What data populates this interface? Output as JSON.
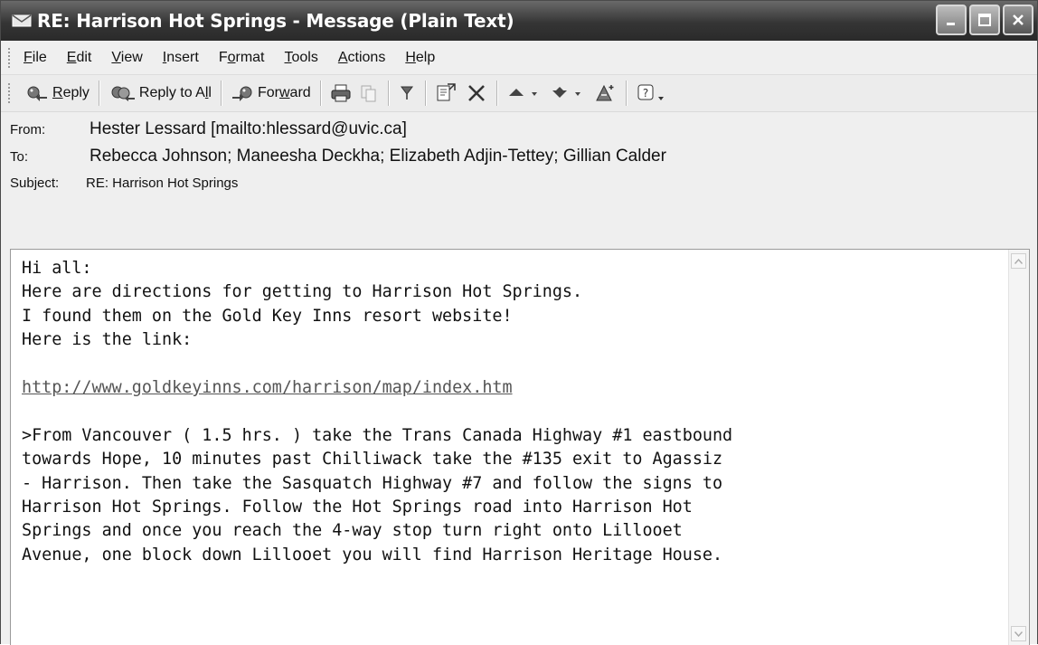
{
  "window": {
    "title": "RE: Harrison Hot Springs - Message (Plain Text)"
  },
  "menu": {
    "items": [
      {
        "label": "File",
        "accel": "F",
        "rest": "ile"
      },
      {
        "label": "Edit",
        "accel": "E",
        "rest": "dit"
      },
      {
        "label": "View",
        "accel": "V",
        "rest": "iew"
      },
      {
        "label": "Insert",
        "accel": "I",
        "rest": "nsert"
      },
      {
        "label": "Format",
        "pre": "F",
        "accel": "o",
        "rest": "rmat"
      },
      {
        "label": "Tools",
        "accel": "T",
        "rest": "ools"
      },
      {
        "label": "Actions",
        "accel": "A",
        "rest": "ctions"
      },
      {
        "label": "Help",
        "accel": "H",
        "rest": "elp"
      }
    ]
  },
  "toolbar": {
    "reply_pre": "",
    "reply_accel": "R",
    "reply_rest": "eply",
    "reply_all_pre": "Reply to A",
    "reply_all_accel": "l",
    "reply_all_rest": "l",
    "forward_pre": "For",
    "forward_accel": "w",
    "forward_rest": "ard"
  },
  "headers": {
    "from_label": "From:",
    "from_value": "Hester Lessard [mailto:hlessard@uvic.ca]",
    "to_label": "To:",
    "to_value": "Rebecca Johnson; Maneesha Deckha; Elizabeth Adjin-Tettey; Gillian Calder",
    "subject_label": "Subject:",
    "subject_value": "RE: Harrison Hot Springs"
  },
  "body": {
    "lines_before_link": [
      "Hi all:",
      "Here are directions for getting to Harrison Hot Springs.",
      "I found them on the Gold Key Inns resort website!",
      "Here is the link:",
      ""
    ],
    "link": "http://www.goldkeyinns.com/harrison/map/index.htm",
    "lines_after_link": [
      "",
      ">From Vancouver ( 1.5 hrs. ) take the Trans Canada Highway #1 eastbound",
      "towards Hope, 10 minutes past Chilliwack take the #135 exit to Agassiz",
      "- Harrison. Then take the Sasquatch Highway #7 and follow the signs to",
      "Harrison Hot Springs. Follow the Hot Springs road into Harrison Hot",
      "Springs and once you reach the 4-way stop turn right onto Lillooet",
      "Avenue, one block down Lillooet you will find Harrison Heritage House."
    ]
  },
  "icons": {
    "app": "envelope-icon",
    "reply": "reply-icon",
    "reply_all": "reply-all-icon",
    "forward": "forward-icon",
    "print": "print-icon",
    "copy": "copy-icon",
    "flag": "flag-icon",
    "move": "move-to-folder-icon",
    "delete": "delete-icon",
    "previous": "previous-item-icon",
    "next": "next-item-icon",
    "address_book": "address-book-icon",
    "help": "help-icon"
  }
}
